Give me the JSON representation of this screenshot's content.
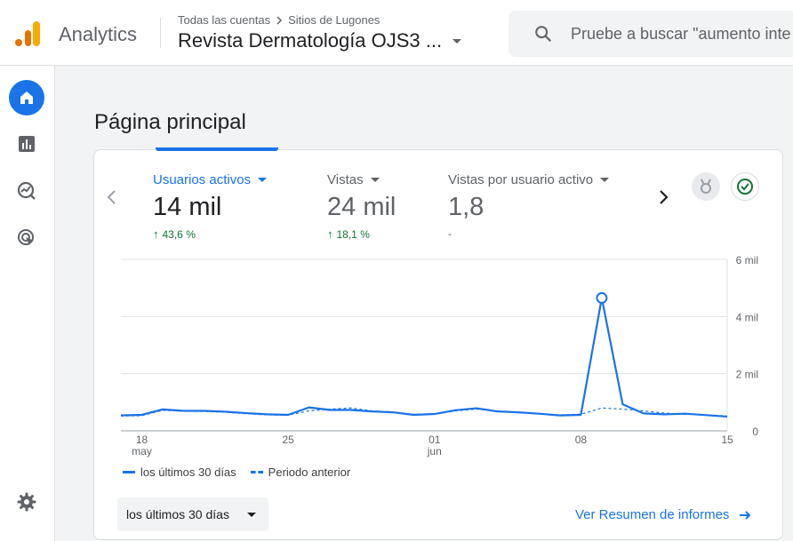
{
  "header": {
    "app_name": "Analytics",
    "breadcrumb": [
      "Todas las cuentas",
      "Sitios de Lugones"
    ],
    "property": "Revista Dermatología OJS3 ...",
    "search_placeholder": "Pruebe a buscar \"aumento inte"
  },
  "sidenav": {
    "items": [
      {
        "name": "home-icon",
        "active": true
      },
      {
        "name": "reports-icon",
        "active": false
      },
      {
        "name": "explore-icon",
        "active": false
      },
      {
        "name": "advertising-icon",
        "active": false
      }
    ],
    "settings": "gear-icon"
  },
  "main": {
    "title": "Página principal",
    "metrics": [
      {
        "label": "Usuarios activos",
        "value": "14 mil",
        "change": "43,6 %",
        "trend": "up",
        "active": true
      },
      {
        "label": "Vistas",
        "value": "24 mil",
        "change": "18,1 %",
        "trend": "up",
        "active": false
      },
      {
        "label": "Vistas por usuario activo",
        "value": "1,8",
        "change": "-",
        "trend": "none",
        "active": false
      }
    ],
    "legend": {
      "current": "los últimos 30 días",
      "previous": "Periodo anterior"
    },
    "range_button": "los últimos 30 días",
    "report_link": "Ver Resumen de informes"
  },
  "colors": {
    "accent": "#1a73e8",
    "positive": "#137333"
  },
  "chart_data": {
    "type": "line",
    "x": [
      "may 17",
      "may 18",
      "may 19",
      "may 20",
      "may 21",
      "may 22",
      "may 23",
      "may 24",
      "may 25",
      "may 26",
      "may 27",
      "may 28",
      "may 29",
      "may 30",
      "may 31",
      "jun 01",
      "jun 02",
      "jun 03",
      "jun 04",
      "jun 05",
      "jun 06",
      "jun 07",
      "jun 08",
      "jun 09",
      "jun 10",
      "jun 11",
      "jun 12",
      "jun 13",
      "jun 14",
      "jun 15"
    ],
    "x_tick_labels": [
      {
        "index": 1,
        "label": "18",
        "sub": "may"
      },
      {
        "index": 8,
        "label": "25",
        "sub": ""
      },
      {
        "index": 15,
        "label": "01",
        "sub": "jun"
      },
      {
        "index": 22,
        "label": "08",
        "sub": ""
      },
      {
        "index": 29,
        "label": "15",
        "sub": ""
      }
    ],
    "y_ticks": [
      {
        "value": 0,
        "label": "0"
      },
      {
        "value": 2000,
        "label": "2 mil"
      },
      {
        "value": 4000,
        "label": "4 mil"
      },
      {
        "value": 6000,
        "label": "6 mil"
      }
    ],
    "ylim": [
      0,
      6000
    ],
    "series": [
      {
        "name": "los últimos 30 días",
        "style": "solid",
        "values": [
          540,
          560,
          750,
          700,
          700,
          670,
          620,
          580,
          560,
          820,
          730,
          730,
          680,
          650,
          560,
          590,
          720,
          790,
          680,
          650,
          600,
          540,
          560,
          4650,
          930,
          610,
          580,
          600,
          550,
          500
        ],
        "highlight_index": 23
      },
      {
        "name": "Periodo anterior",
        "style": "dashed",
        "values": [
          520,
          530,
          720,
          690,
          680,
          650,
          600,
          560,
          550,
          700,
          760,
          800,
          700,
          660,
          580,
          600,
          700,
          760,
          690,
          640,
          590,
          560,
          580,
          800,
          760,
          700,
          620,
          580,
          560,
          520
        ]
      }
    ]
  }
}
